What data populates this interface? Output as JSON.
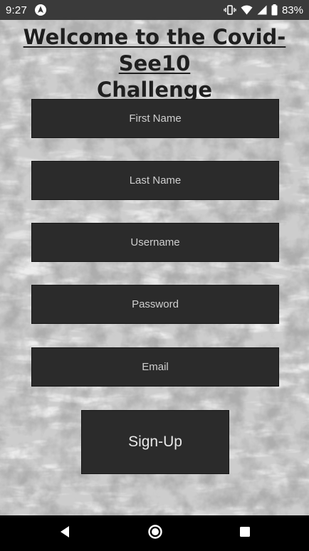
{
  "status_bar": {
    "time": "9:27",
    "battery_percent": "83%",
    "icons": [
      "navigation-app-icon",
      "vibrate-icon",
      "wifi-icon",
      "signal-icon",
      "battery-icon"
    ]
  },
  "title": {
    "line1": "Welcome to the Covid-See10",
    "line2": "Challenge"
  },
  "form": {
    "first_name_placeholder": "First Name",
    "last_name_placeholder": "Last Name",
    "username_placeholder": "Username",
    "password_placeholder": "Password",
    "email_placeholder": "Email",
    "signup_label": "Sign-Up"
  },
  "nav": {
    "icons": [
      "back-icon",
      "home-icon",
      "recents-icon"
    ]
  },
  "colors": {
    "field_bg": "#2b2b2b",
    "placeholder_text": "#cfcfcf",
    "background": "#ececec",
    "status_bar": "#3a3a3a",
    "nav_bar": "#000000"
  }
}
